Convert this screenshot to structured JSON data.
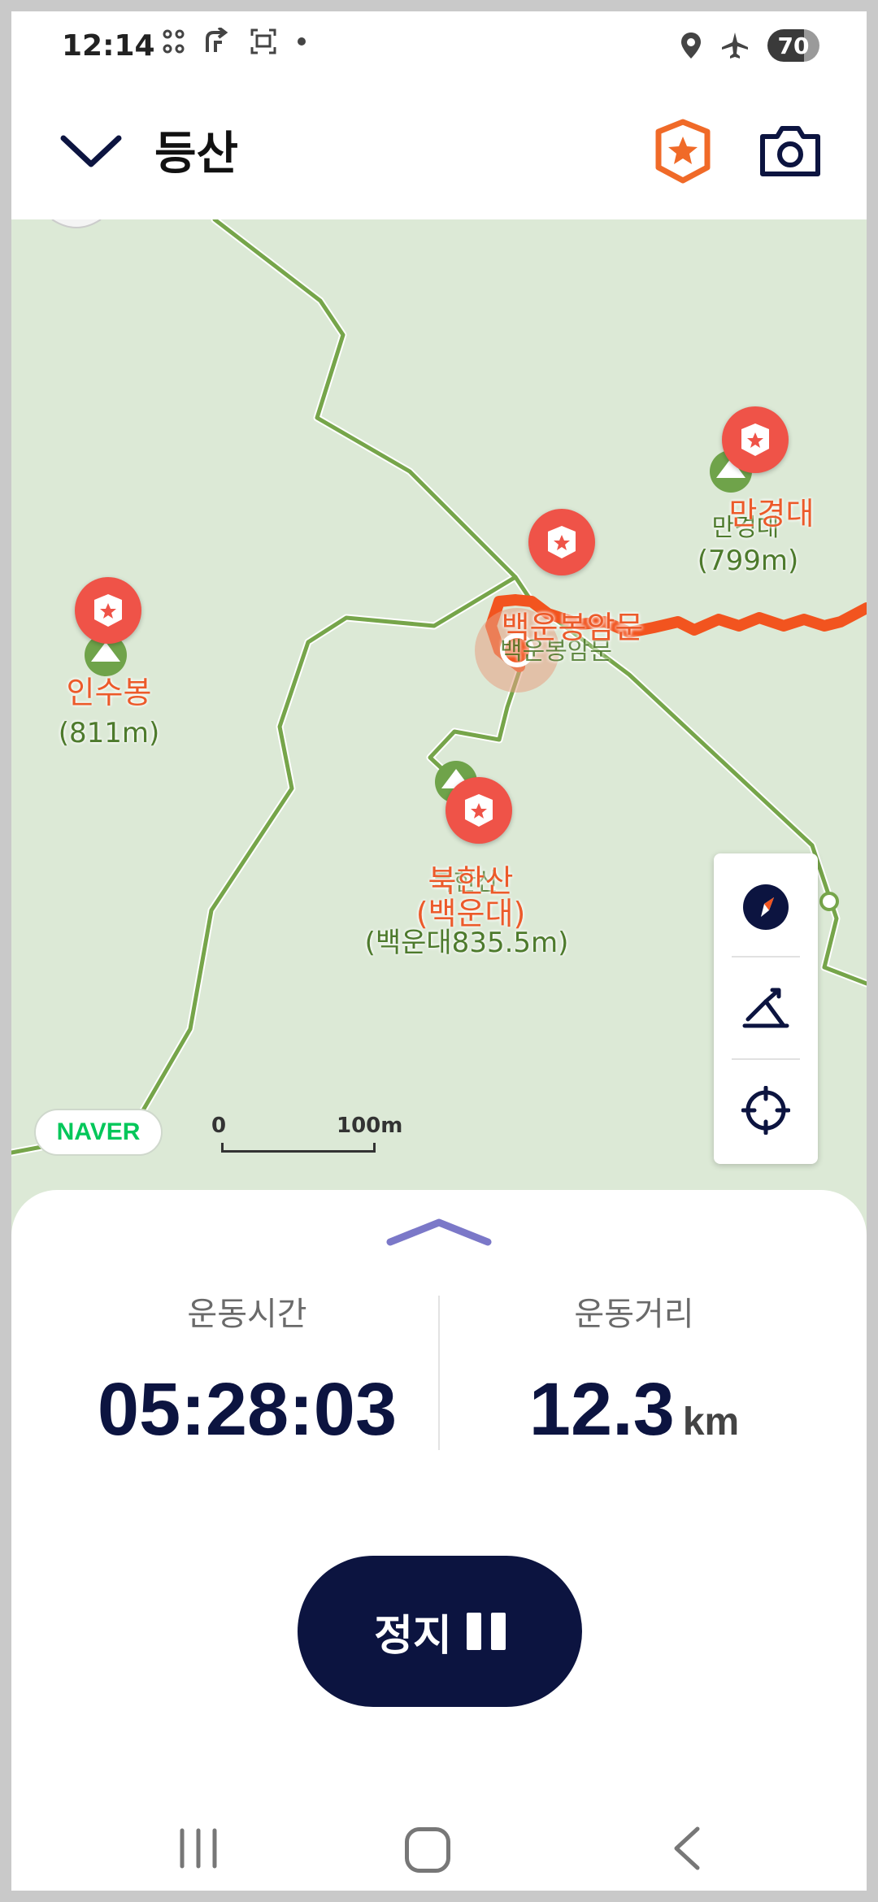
{
  "status_bar": {
    "time": "12:14",
    "battery": "70",
    "left_icons": [
      "grid-dots-icon",
      "navigation-arrow-icon",
      "screenshot-icon",
      "dot-icon"
    ],
    "right_icons": [
      "location-icon",
      "airplane-icon",
      "battery-icon"
    ]
  },
  "app_bar": {
    "title": "등산",
    "back_icon": "chevron-down-icon",
    "actions": [
      "map-badge-icon",
      "camera-icon"
    ],
    "accent_color": "#f06a28"
  },
  "map": {
    "provider_logo": "NAVER",
    "scale": {
      "start": "0",
      "end": "100m"
    },
    "pois": [
      {
        "name": "인수봉",
        "elevation": "(811m)"
      },
      {
        "name": "백운봉암문",
        "sub": "백운봉암문"
      },
      {
        "name": "만경대",
        "sub": "만경대",
        "elevation": "(799m)"
      },
      {
        "name": "북한산",
        "name2": "(백운대)",
        "sub": "북한산",
        "elevation": "(백운대835.5m)"
      }
    ],
    "controls": [
      "compass-icon",
      "terrain-icon",
      "my-location-icon"
    ],
    "route_color": "#f2541f",
    "trail_color": "#76a54a"
  },
  "workout": {
    "time_label": "운동시간",
    "time_value": "05:28:03",
    "distance_label": "운동거리",
    "distance_value": "12.3",
    "distance_unit": "km",
    "stop_label": "정지"
  },
  "nav_bar": {
    "buttons": [
      "recents-icon",
      "home-icon",
      "back-icon"
    ]
  }
}
